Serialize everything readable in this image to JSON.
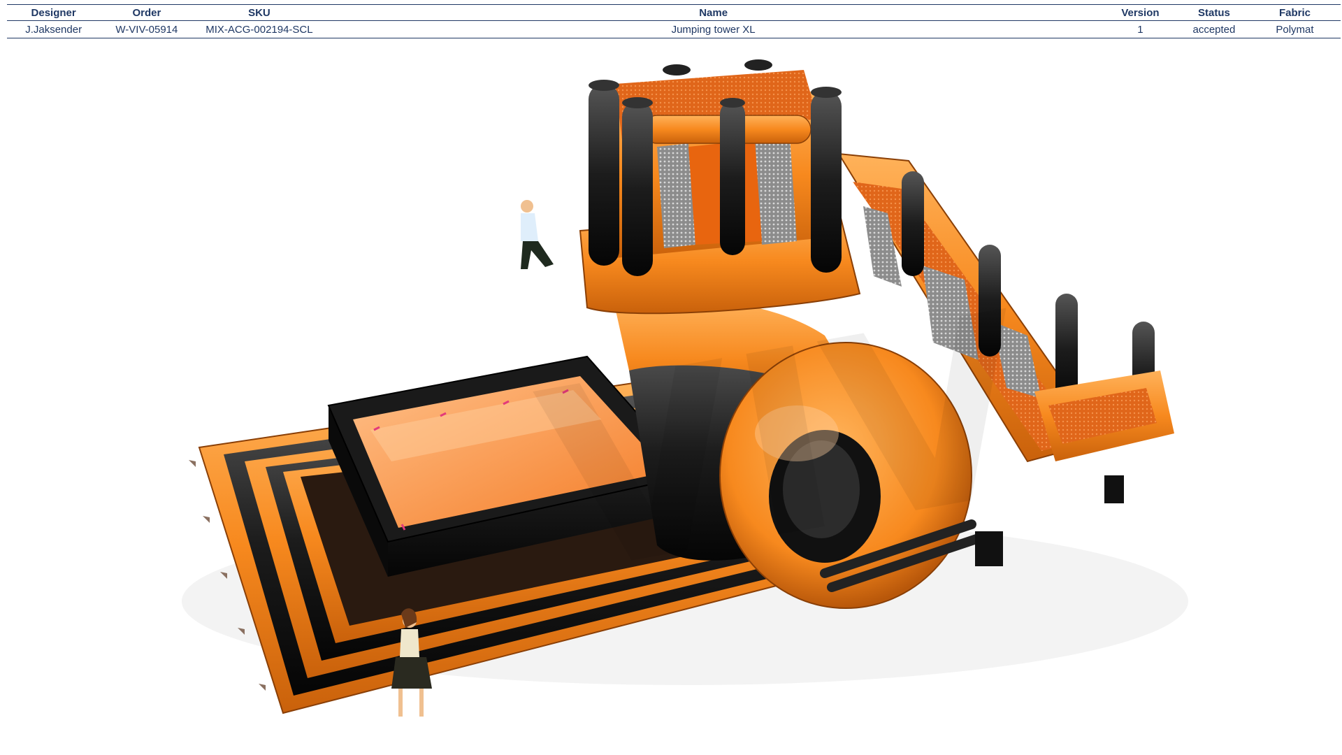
{
  "table": {
    "headers": {
      "designer": "Designer",
      "order": "Order",
      "sku": "SKU",
      "name": "Name",
      "version": "Version",
      "status": "Status",
      "fabric": "Fabric"
    },
    "row": {
      "designer": "J.Jaksender",
      "order": "W-VIV-05914",
      "sku": "MIX-ACG-002194-SCL",
      "name": "Jumping tower XL",
      "version": "1",
      "status": "accepted",
      "fabric": "Polymat"
    }
  },
  "render": {
    "watermark": "VIV",
    "colors": {
      "primary_orange": "#f7891e",
      "dark_orange": "#c9610b",
      "black": "#1a1a1a",
      "mesh": "#9a9a9a",
      "table_text": "#1f3864"
    }
  }
}
